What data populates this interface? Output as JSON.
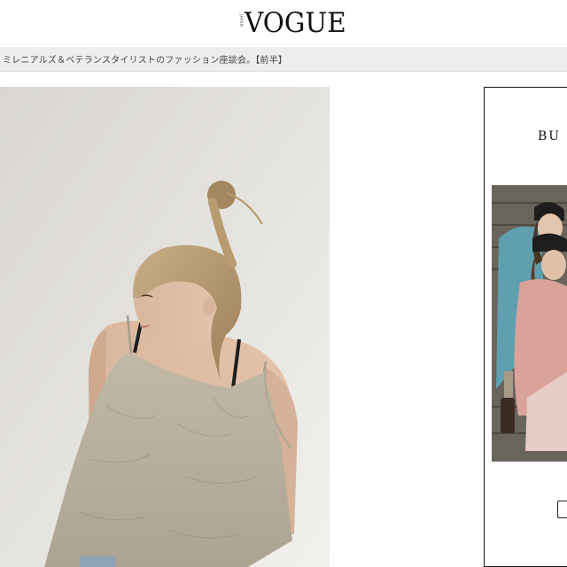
{
  "header": {
    "logo_main": "VOGUE",
    "logo_sub": "JAPAN"
  },
  "title_bar": {
    "text": "ミレニアルズ＆ベテランスタイリストのファッション座談会。【前半】"
  },
  "main_image": {
    "alt": "Young woman with a topknot bun wearing a beige linen camisole over a black bralette, looking over her shoulder"
  },
  "ad": {
    "brand_text": "BU",
    "image_alt": "Two models wearing beanies and faux fur coats seated on stone steps"
  },
  "colors": {
    "title_bar_bg": "#ededed",
    "page_bg": "#ffffff",
    "text": "#111111"
  }
}
